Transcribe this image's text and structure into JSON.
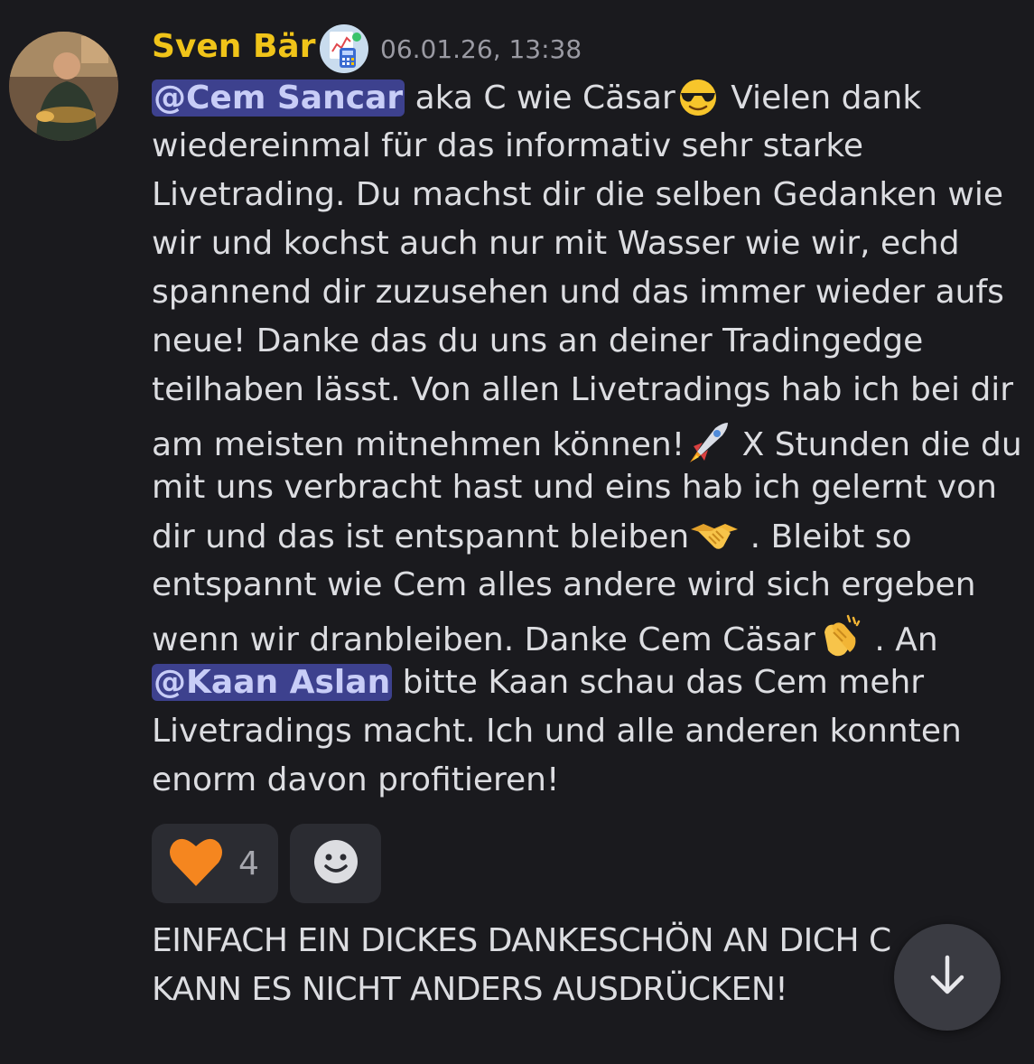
{
  "message": {
    "author": "Sven Bär",
    "author_color": "#f0c419",
    "timestamp": "06.01.26, 13:38",
    "badge_icon": "calculator-chart-icon",
    "lines": {
      "l1_mention": "@Cem Sancar",
      "l1_text_a": " aka C wie Cäsar",
      "l1_text_b": "  Vielen dank",
      "l2": "wiedereinmal für das informativ sehr starke",
      "l3": "Livetrading. Du machst dir die selben Gedanken wie",
      "l4": "wir und kochst auch nur mit Wasser wie wir, echd",
      "l5": "spannend dir zuzusehen und das immer wieder aufs",
      "l6": "neue!  Danke das du uns an deiner Tradingedge",
      "l7": "teilhaben lässt. Von allen Livetradings hab ich bei dir",
      "l8_a": "am meisten mitnehmen können!",
      "l8_b": "  X Stunden die du",
      "l9": "mit uns verbracht hast und eins hab ich gelernt von",
      "l10_a": "dir und das ist entspannt bleiben",
      "l10_b": " . Bleibt so",
      "l11": "entspannt wie Cem alles andere wird sich ergeben",
      "l12_a": "wenn wir dranbleiben. Danke Cem Cäsar",
      "l12_b": " . An",
      "l13_mention": "@Kaan Aslan",
      "l13_text": " bitte Kaan schau das Cem mehr",
      "l14": "Livetradings macht. Ich und alle anderen konnten",
      "l15": "enorm davon profitieren!"
    },
    "emojis": [
      "sunglasses-emoji",
      "rocket-emoji",
      "handshake-emoji",
      "clapping-hands-emoji"
    ],
    "mention_color": "#3d418e"
  },
  "reactions": {
    "heart": {
      "icon": "orange-heart-icon",
      "count": "4",
      "color": "#f5861f"
    },
    "add_icon": "add-reaction-smiley-icon"
  },
  "next_message": {
    "line1": "EINFACH EIN DICKES DANKESCHÖN AN DICH C",
    "line2": "KANN ES NICHT ANDERS AUSDRÜCKEN!"
  },
  "scroll_button": {
    "icon": "arrow-down-icon"
  }
}
